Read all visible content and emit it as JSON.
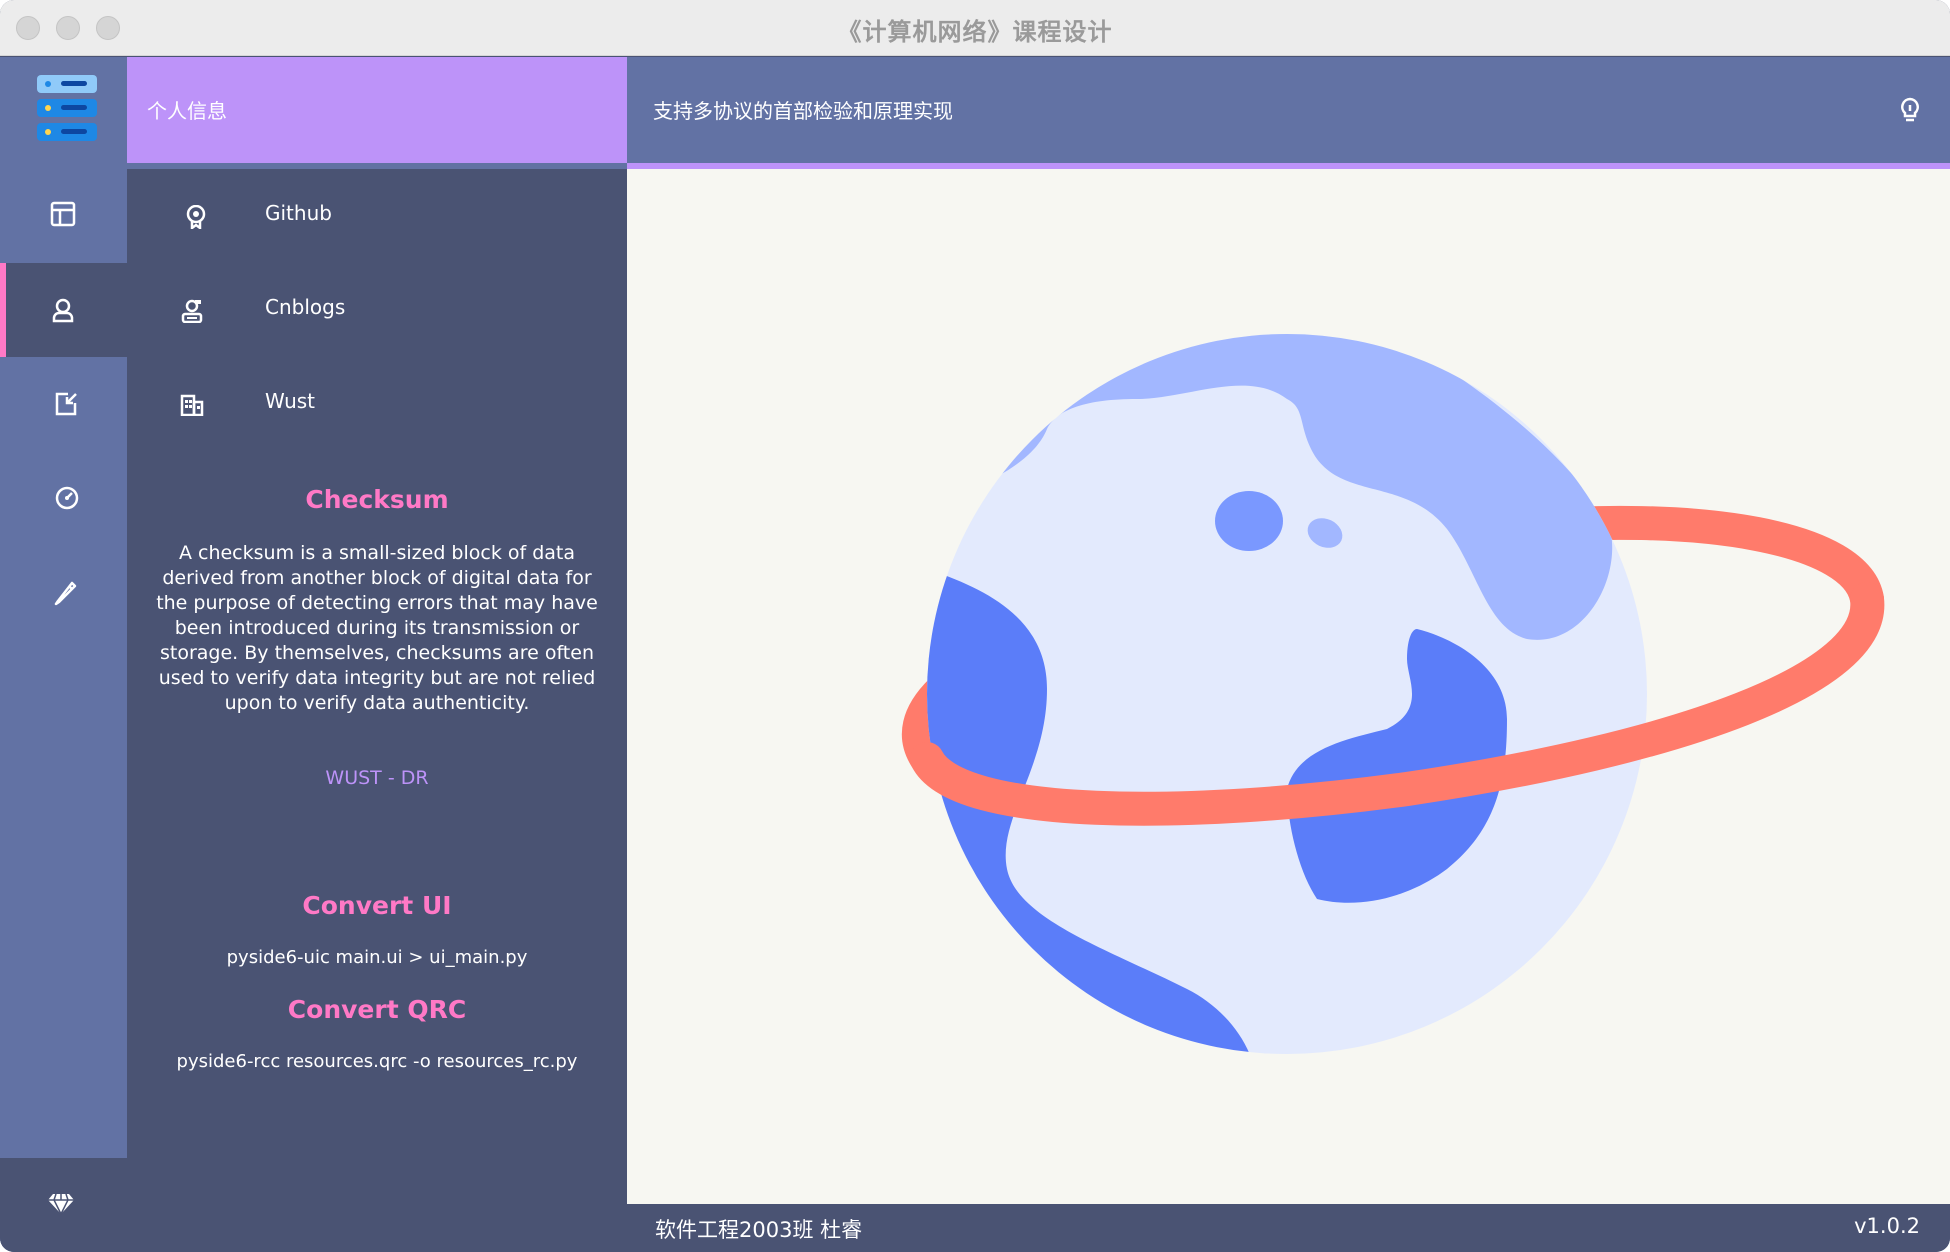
{
  "window": {
    "title": "《计算机网络》课程设计"
  },
  "sidebar": {
    "logo_icon": "server-stack-icon",
    "items": [
      {
        "icon": "table-icon",
        "active": false
      },
      {
        "icon": "user-icon",
        "active": true
      },
      {
        "icon": "exit-icon",
        "active": false
      },
      {
        "icon": "gauge-icon",
        "active": false
      },
      {
        "icon": "pencil-icon",
        "active": false
      }
    ],
    "bottom_icon": "diamond-icon"
  },
  "left_panel": {
    "header": "个人信息",
    "links": [
      {
        "icon": "github-badge-icon",
        "label": "Github"
      },
      {
        "icon": "user-badge-icon",
        "label": "Cnblogs"
      },
      {
        "icon": "building-icon",
        "label": "Wust"
      }
    ],
    "checksum": {
      "title": "Checksum",
      "text": "A checksum is a small-sized block of data derived from another block of digital data for the purpose of detecting errors that may have been introduced during its transmission or storage. By themselves, checksums are often used to verify data integrity but are not relied upon to verify data authenticity.",
      "signature": "WUST - DR"
    },
    "convert_ui": {
      "title": "Convert UI",
      "command": "pyside6-uic main.ui > ui_main.py"
    },
    "convert_qrc": {
      "title": "Convert QRC",
      "command": "pyside6-rcc resources.qrc -o resources_rc.py"
    }
  },
  "main": {
    "header": "支持多协议的首部检验和原理实现",
    "header_icon": "lightbulb-icon",
    "illustration": "planet-illustration",
    "footer_left": "软件工程2003班 杜睿",
    "footer_right": "v1.0.2"
  },
  "colors": {
    "background": "#4a5373",
    "sidebar": "#6272a4",
    "accent_purple": "#bd93f9",
    "accent_pink": "#ff79c6",
    "canvas": "#f7f7f2"
  }
}
